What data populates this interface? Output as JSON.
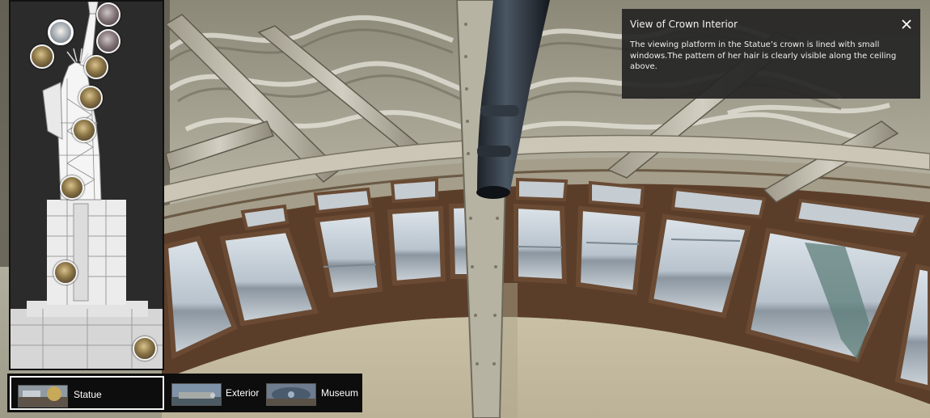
{
  "info_box": {
    "title": "View of Crown Interior",
    "description": "The viewing platform in the Statue’s crown is lined with small windows.The pattern of her hair is clearly visible along the ceiling above.",
    "close_icon": "close-icon"
  },
  "tabs": [
    {
      "label": "Statue",
      "active": true,
      "icon": "statue-thumbnail"
    },
    {
      "label": "Exterior",
      "active": false,
      "icon": "exterior-thumbnail"
    },
    {
      "label": "Museum",
      "active": false,
      "icon": "museum-thumbnail"
    }
  ],
  "statue_map": {
    "hotspot_count": 11,
    "active_hotspot": "crown"
  },
  "colors": {
    "panel_bg": "#2b2b2b",
    "info_bg": "#262626",
    "tab_bar_bg": "#0d0d0d",
    "text": "#f0f0f0"
  }
}
